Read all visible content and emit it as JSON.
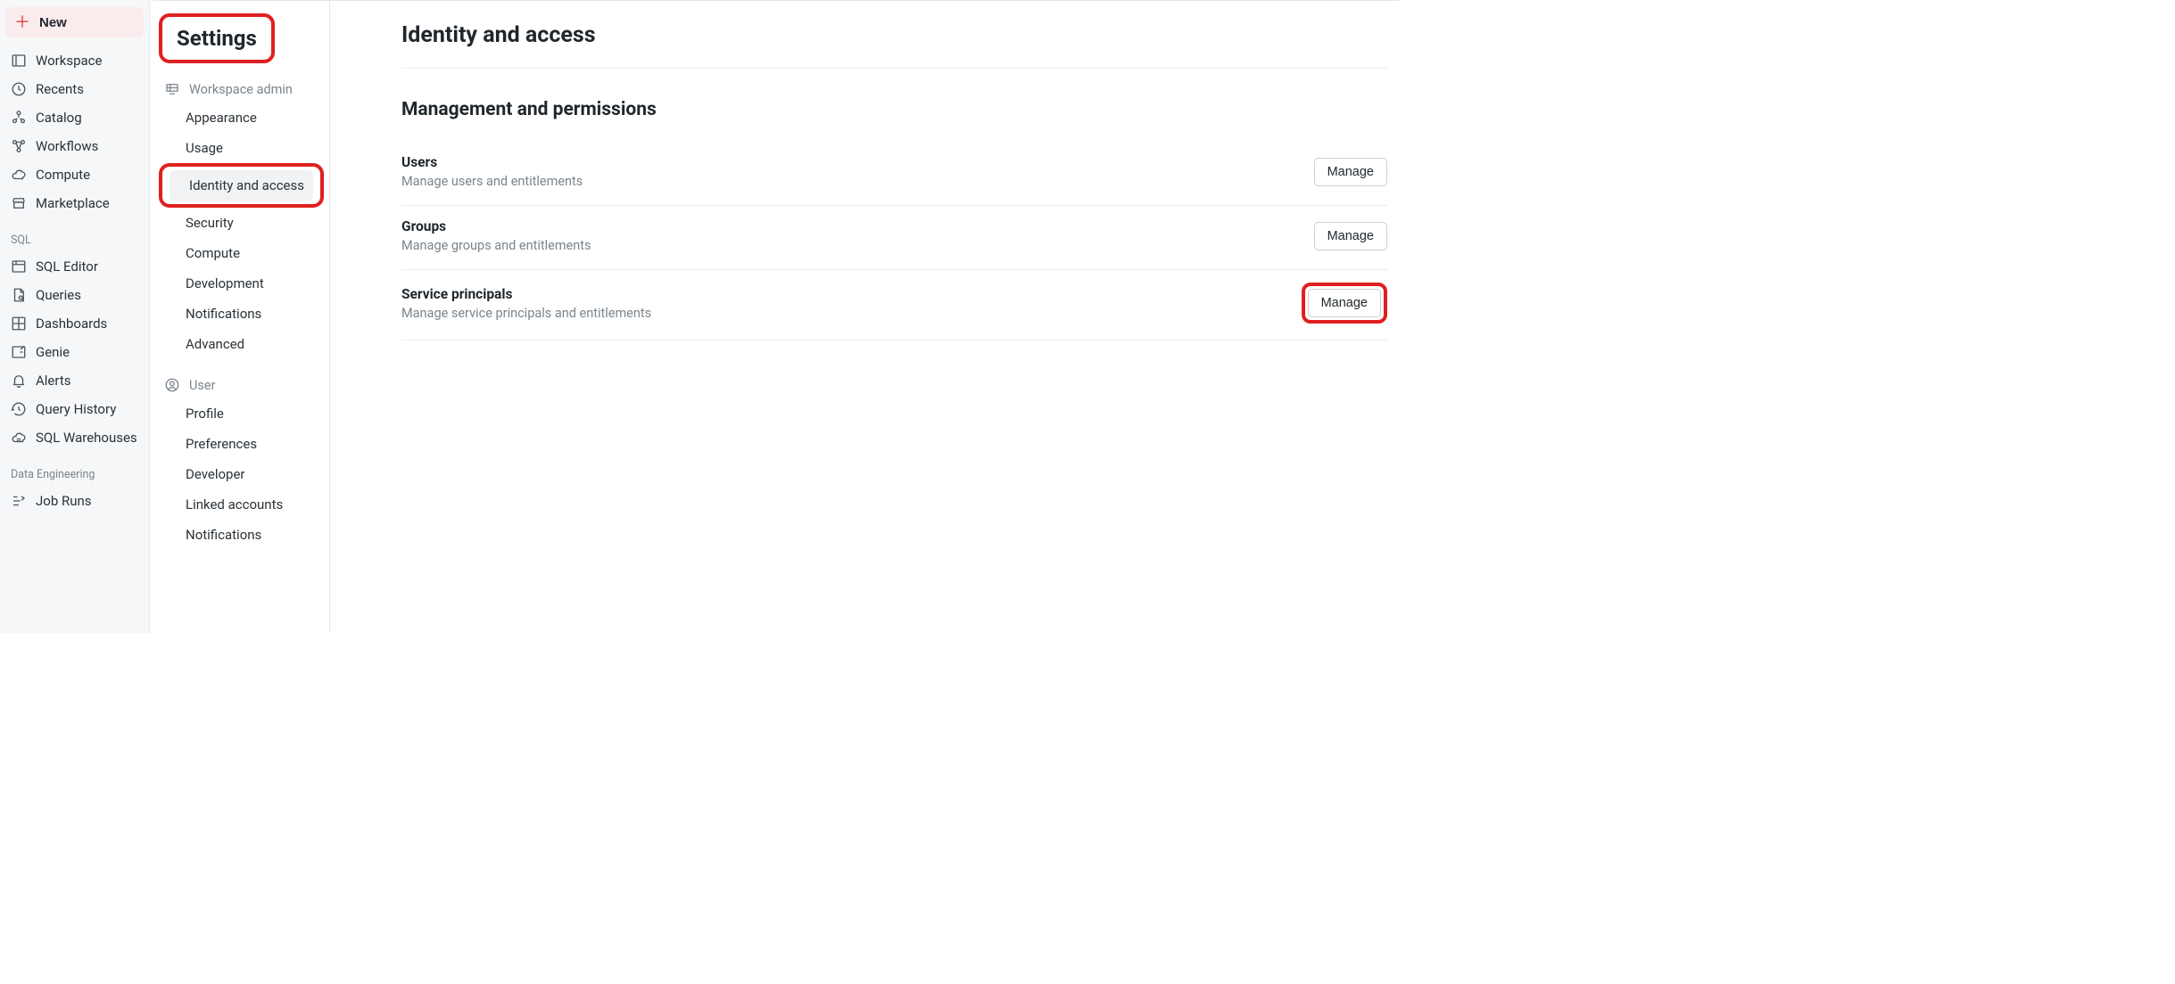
{
  "nav": {
    "new_label": "New",
    "items": [
      {
        "label": "Workspace",
        "icon": "workspace-icon"
      },
      {
        "label": "Recents",
        "icon": "clock-icon"
      },
      {
        "label": "Catalog",
        "icon": "catalog-icon"
      },
      {
        "label": "Workflows",
        "icon": "workflows-icon"
      },
      {
        "label": "Compute",
        "icon": "cloud-icon"
      },
      {
        "label": "Marketplace",
        "icon": "storefront-icon"
      }
    ],
    "sql_label": "SQL",
    "sql_items": [
      {
        "label": "SQL Editor",
        "icon": "sql-editor-icon"
      },
      {
        "label": "Queries",
        "icon": "queries-icon"
      },
      {
        "label": "Dashboards",
        "icon": "dashboard-icon"
      },
      {
        "label": "Genie",
        "icon": "genie-icon"
      },
      {
        "label": "Alerts",
        "icon": "bell-icon"
      },
      {
        "label": "Query History",
        "icon": "history-icon"
      },
      {
        "label": "SQL Warehouses",
        "icon": "warehouse-icon"
      }
    ],
    "de_label": "Data Engineering",
    "de_items": [
      {
        "label": "Job Runs",
        "icon": "job-runs-icon"
      }
    ]
  },
  "settings": {
    "title": "Settings",
    "groups": [
      {
        "header": "Workspace admin",
        "icon": "admin-icon",
        "items": [
          {
            "label": "Appearance"
          },
          {
            "label": "Usage"
          },
          {
            "label": "Identity and access",
            "active": true,
            "highlight": true
          },
          {
            "label": "Security"
          },
          {
            "label": "Compute"
          },
          {
            "label": "Development"
          },
          {
            "label": "Notifications"
          },
          {
            "label": "Advanced"
          }
        ]
      },
      {
        "header": "User",
        "icon": "user-icon",
        "items": [
          {
            "label": "Profile"
          },
          {
            "label": "Preferences"
          },
          {
            "label": "Developer"
          },
          {
            "label": "Linked accounts"
          },
          {
            "label": "Notifications"
          }
        ]
      }
    ]
  },
  "content": {
    "page_title": "Identity and access",
    "section_title": "Management and permissions",
    "rows": [
      {
        "title": "Users",
        "subtitle": "Manage users and entitlements",
        "button": "Manage"
      },
      {
        "title": "Groups",
        "subtitle": "Manage groups and entitlements",
        "button": "Manage"
      },
      {
        "title": "Service principals",
        "subtitle": "Manage service principals and entitlements",
        "button": "Manage",
        "highlight_button": true
      }
    ]
  }
}
